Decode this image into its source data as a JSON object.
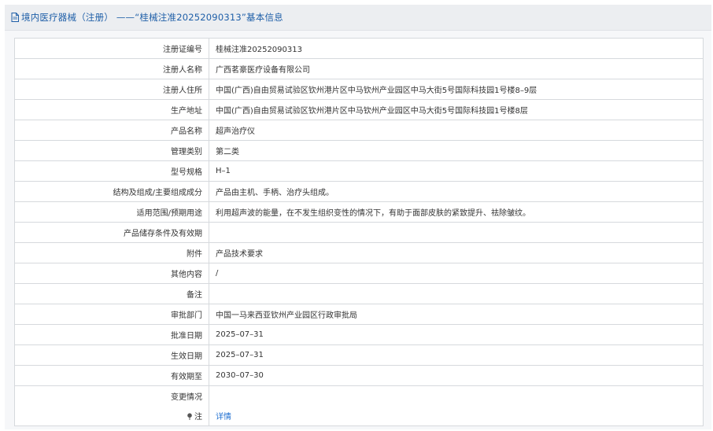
{
  "header": {
    "title": "境内医疗器械（注册） ——“桂械注准20252090313”基本信息"
  },
  "rows": [
    {
      "label": "注册证编号",
      "value": "桂械注准20252090313"
    },
    {
      "label": "注册人名称",
      "value": "广西茗豪医疗设备有限公司"
    },
    {
      "label": "注册人住所",
      "value": "中国(广西)自由贸易试验区钦州港片区中马钦州产业园区中马大街5号国际科技园1号楼8–9层"
    },
    {
      "label": "生产地址",
      "value": "中国(广西)自由贸易试验区钦州港片区中马钦州产业园区中马大街5号国际科技园1号楼8层"
    },
    {
      "label": "产品名称",
      "value": "超声治疗仪"
    },
    {
      "label": "管理类别",
      "value": "第二类"
    },
    {
      "label": "型号规格",
      "value": "H–1"
    },
    {
      "label": "结构及组成/主要组成成分",
      "value": "产品由主机、手柄、治疗头组成。"
    },
    {
      "label": "适用范围/预期用途",
      "value": "利用超声波的能量，在不发生组织变性的情况下，有助于面部皮肤的紧致提升、祛除皱纹。"
    },
    {
      "label": "产品储存条件及有效期",
      "value": ""
    },
    {
      "label": "附件",
      "value": "产品技术要求"
    },
    {
      "label": "其他内容",
      "value": "/"
    },
    {
      "label": "备注",
      "value": ""
    },
    {
      "label": "审批部门",
      "value": "中国一马来西亚钦州产业园区行政审批局"
    },
    {
      "label": "批准日期",
      "value": "2025–07–31"
    },
    {
      "label": "生效日期",
      "value": "2025–07–31"
    },
    {
      "label": "有效期至",
      "value": "2030–07–30"
    },
    {
      "label": "变更情况",
      "value": ""
    }
  ],
  "note": {
    "label": "注",
    "link_text": "详情",
    "icon": "pin-icon"
  },
  "colors": {
    "header_text": "#1f5fa8",
    "link": "#1f6fd0",
    "border": "#d6d9dd"
  }
}
